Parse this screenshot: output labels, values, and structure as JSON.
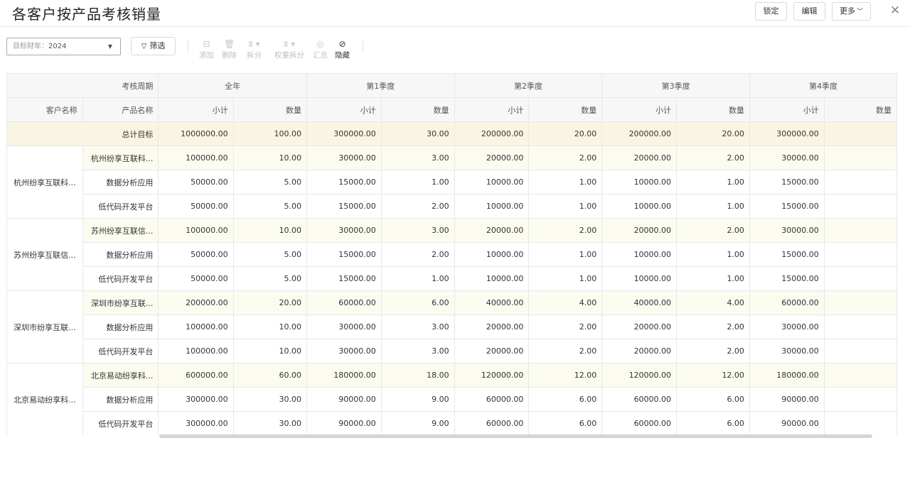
{
  "page": {
    "title": "各客户按产品考核销量",
    "buttons": {
      "lock": "锁定",
      "edit": "编辑",
      "more": "更多"
    }
  },
  "toolbar": {
    "year_label": "目标财年：",
    "year_value": "2024",
    "filter_label": "筛选",
    "tools": [
      {
        "label": "添加",
        "icon": "add-row-icon",
        "enabled": false
      },
      {
        "label": "删除",
        "icon": "trash-icon",
        "enabled": false
      },
      {
        "label": "拆分",
        "icon": "split-icon",
        "enabled": false
      },
      {
        "label": "权重拆分",
        "icon": "weight-split-icon",
        "enabled": false
      },
      {
        "label": "汇总",
        "icon": "sum-icon",
        "enabled": false
      },
      {
        "label": "隐藏",
        "icon": "eye-off-icon",
        "enabled": true
      }
    ]
  },
  "grid": {
    "period_header": "考核周期",
    "customer_header": "客户名称",
    "product_header": "产品名称",
    "periods": [
      "全年",
      "第1季度",
      "第2季度",
      "第3季度",
      "第4季度"
    ],
    "subtotal_label": "小计",
    "quantity_label": "数量",
    "total_label": "总计目标",
    "total_values": [
      "1000000.00",
      "100.00",
      "300000.00",
      "30.00",
      "200000.00",
      "20.00",
      "200000.00",
      "20.00",
      "300000.00",
      ""
    ],
    "groups": [
      {
        "customer": "杭州纷享互联科...",
        "rows": [
          {
            "product": "杭州纷享互联科...",
            "values": [
              "100000.00",
              "10.00",
              "30000.00",
              "3.00",
              "20000.00",
              "2.00",
              "20000.00",
              "2.00",
              "30000.00",
              ""
            ]
          },
          {
            "product": "数据分析应用",
            "values": [
              "50000.00",
              "5.00",
              "15000.00",
              "1.00",
              "10000.00",
              "1.00",
              "10000.00",
              "1.00",
              "15000.00",
              ""
            ]
          },
          {
            "product": "低代码开发平台",
            "values": [
              "50000.00",
              "5.00",
              "15000.00",
              "2.00",
              "10000.00",
              "1.00",
              "10000.00",
              "1.00",
              "15000.00",
              ""
            ]
          }
        ]
      },
      {
        "customer": "苏州纷享互联信...",
        "rows": [
          {
            "product": "苏州纷享互联信...",
            "values": [
              "100000.00",
              "10.00",
              "30000.00",
              "3.00",
              "20000.00",
              "2.00",
              "20000.00",
              "2.00",
              "30000.00",
              ""
            ]
          },
          {
            "product": "数据分析应用",
            "values": [
              "50000.00",
              "5.00",
              "15000.00",
              "2.00",
              "10000.00",
              "1.00",
              "10000.00",
              "1.00",
              "15000.00",
              ""
            ]
          },
          {
            "product": "低代码开发平台",
            "values": [
              "50000.00",
              "5.00",
              "15000.00",
              "1.00",
              "10000.00",
              "1.00",
              "10000.00",
              "1.00",
              "15000.00",
              ""
            ]
          }
        ]
      },
      {
        "customer": "深圳市纷享互联...",
        "rows": [
          {
            "product": "深圳市纷享互联...",
            "values": [
              "200000.00",
              "20.00",
              "60000.00",
              "6.00",
              "40000.00",
              "4.00",
              "40000.00",
              "4.00",
              "60000.00",
              ""
            ]
          },
          {
            "product": "数据分析应用",
            "values": [
              "100000.00",
              "10.00",
              "30000.00",
              "3.00",
              "20000.00",
              "2.00",
              "20000.00",
              "2.00",
              "30000.00",
              ""
            ]
          },
          {
            "product": "低代码开发平台",
            "values": [
              "100000.00",
              "10.00",
              "30000.00",
              "3.00",
              "20000.00",
              "2.00",
              "20000.00",
              "2.00",
              "30000.00",
              ""
            ]
          }
        ]
      },
      {
        "customer": "北京易动纷享科...",
        "rows": [
          {
            "product": "北京易动纷享科...",
            "values": [
              "600000.00",
              "60.00",
              "180000.00",
              "18.00",
              "120000.00",
              "12.00",
              "120000.00",
              "12.00",
              "180000.00",
              ""
            ]
          },
          {
            "product": "数据分析应用",
            "values": [
              "300000.00",
              "30.00",
              "90000.00",
              "9.00",
              "60000.00",
              "6.00",
              "60000.00",
              "6.00",
              "90000.00",
              ""
            ]
          },
          {
            "product": "低代码开发平台",
            "values": [
              "300000.00",
              "30.00",
              "90000.00",
              "9.00",
              "60000.00",
              "6.00",
              "60000.00",
              "6.00",
              "90000.00",
              ""
            ]
          }
        ]
      }
    ]
  }
}
